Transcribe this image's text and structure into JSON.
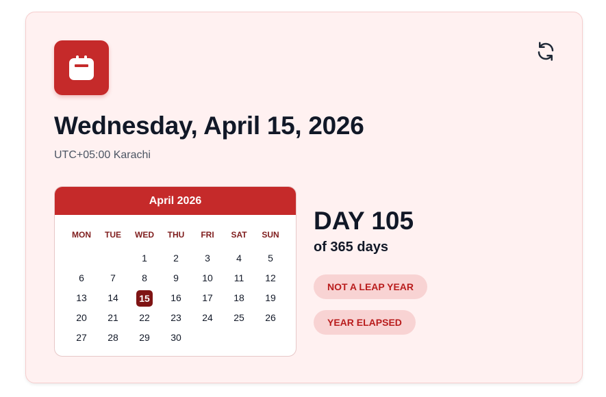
{
  "header": {
    "date_title": "Wednesday, April 15, 2026",
    "timezone": "UTC+05:00 Karachi",
    "app_icon": "calendar-icon",
    "refresh_icon": "refresh-icon"
  },
  "calendar": {
    "month_label": "April 2026",
    "weekdays": [
      "MON",
      "TUE",
      "WED",
      "THU",
      "FRI",
      "SAT",
      "SUN"
    ],
    "weeks": [
      [
        "",
        "",
        "1",
        "2",
        "3",
        "4",
        "5"
      ],
      [
        "6",
        "7",
        "8",
        "9",
        "10",
        "11",
        "12"
      ],
      [
        "13",
        "14",
        "15",
        "16",
        "17",
        "18",
        "19"
      ],
      [
        "20",
        "21",
        "22",
        "23",
        "24",
        "25",
        "26"
      ],
      [
        "27",
        "28",
        "29",
        "30",
        "",
        "",
        ""
      ]
    ],
    "selected_day": "15"
  },
  "stats": {
    "day_label": "DAY 105",
    "of_days": "of 365 days",
    "badges": [
      "NOT A LEAP YEAR",
      "YEAR ELAPSED"
    ]
  },
  "colors": {
    "accent": "#c52a2a",
    "selected_day_bg": "#7f1414",
    "card_bg": "#fff1f1",
    "badge_bg": "#f8d3d3",
    "badge_text": "#b91c1c"
  }
}
